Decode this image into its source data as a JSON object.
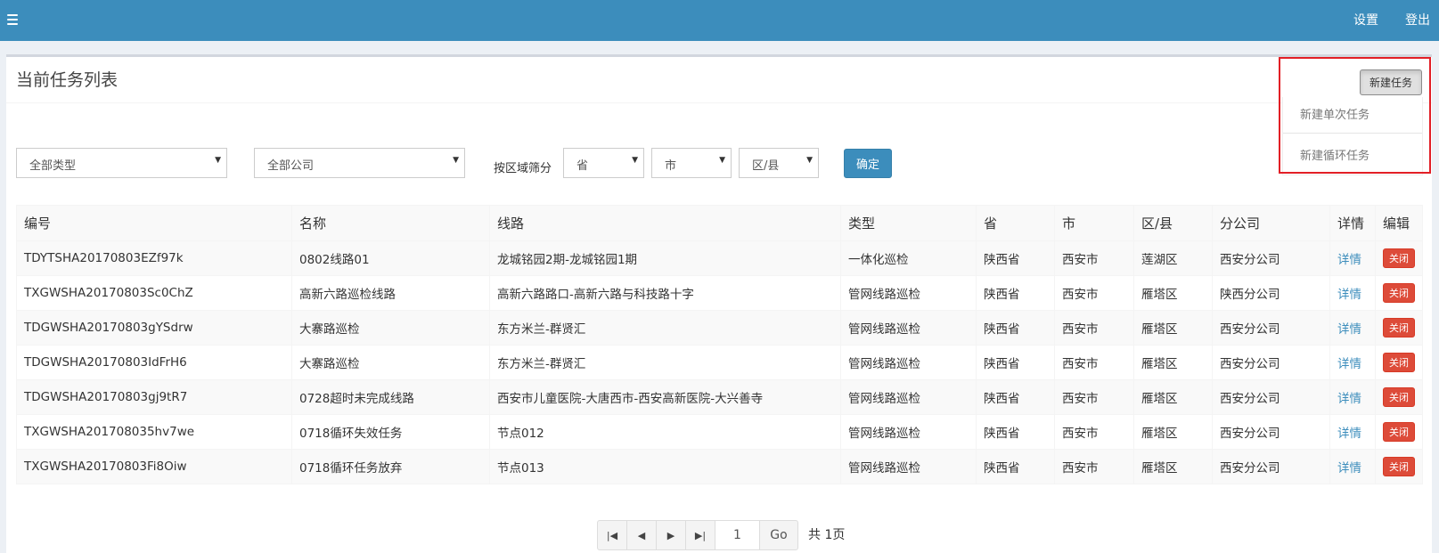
{
  "topbar": {
    "settings": "设置",
    "logout": "登出"
  },
  "box": {
    "title": "当前任务列表",
    "new_task_button": "新建任务",
    "dropdown_items": [
      "新建单次任务",
      "新建循环任务"
    ]
  },
  "filters": {
    "type_select": "全部类型",
    "company_select": "全部公司",
    "region_label": "按区域筛分",
    "province_select": "省",
    "city_select": "市",
    "district_select": "区/县",
    "confirm_button": "确定"
  },
  "table": {
    "columns": [
      "编号",
      "名称",
      "线路",
      "类型",
      "省",
      "市",
      "区/县",
      "分公司",
      "详情",
      "编辑"
    ],
    "rows": [
      {
        "id": "TDYTSHA20170803EZf97k",
        "name": "0802线路01",
        "route": "龙城铭园2期-龙城铭园1期",
        "type": "一体化巡检",
        "province": "陕西省",
        "city": "西安市",
        "district": "莲湖区",
        "branch": "西安分公司",
        "detail": "详情",
        "edit": "关闭"
      },
      {
        "id": "TXGWSHA20170803Sc0ChZ",
        "name": "高新六路巡检线路",
        "route": "高新六路路口-高新六路与科技路十字",
        "type": "管网线路巡检",
        "province": "陕西省",
        "city": "西安市",
        "district": "雁塔区",
        "branch": "陕西分公司",
        "detail": "详情",
        "edit": "关闭"
      },
      {
        "id": "TDGWSHA20170803gYSdrw",
        "name": "大寨路巡检",
        "route": "东方米兰-群贤汇",
        "type": "管网线路巡检",
        "province": "陕西省",
        "city": "西安市",
        "district": "雁塔区",
        "branch": "西安分公司",
        "detail": "详情",
        "edit": "关闭"
      },
      {
        "id": "TDGWSHA20170803IdFrH6",
        "name": "大寨路巡检",
        "route": "东方米兰-群贤汇",
        "type": "管网线路巡检",
        "province": "陕西省",
        "city": "西安市",
        "district": "雁塔区",
        "branch": "西安分公司",
        "detail": "详情",
        "edit": "关闭"
      },
      {
        "id": "TDGWSHA20170803gj9tR7",
        "name": "0728超时未完成线路",
        "route": "西安市儿童医院-大唐西市-西安高新医院-大兴善寺",
        "type": "管网线路巡检",
        "province": "陕西省",
        "city": "西安市",
        "district": "雁塔区",
        "branch": "西安分公司",
        "detail": "详情",
        "edit": "关闭"
      },
      {
        "id": "TXGWSHA201708035hv7we",
        "name": "0718循环失效任务",
        "route": "节点012",
        "type": "管网线路巡检",
        "province": "陕西省",
        "city": "西安市",
        "district": "雁塔区",
        "branch": "西安分公司",
        "detail": "详情",
        "edit": "关闭"
      },
      {
        "id": "TXGWSHA20170803Fi8Oiw",
        "name": "0718循环任务放弃",
        "route": "节点013",
        "type": "管网线路巡检",
        "province": "陕西省",
        "city": "西安市",
        "district": "雁塔区",
        "branch": "西安分公司",
        "detail": "详情",
        "edit": "关闭"
      }
    ]
  },
  "pager": {
    "page_value": "1",
    "go_label": "Go",
    "total": "共 1页"
  },
  "colors": {
    "topbar": "#3c8dbc",
    "close_button": "#dd4b39",
    "highlight_border": "#e21f26"
  }
}
